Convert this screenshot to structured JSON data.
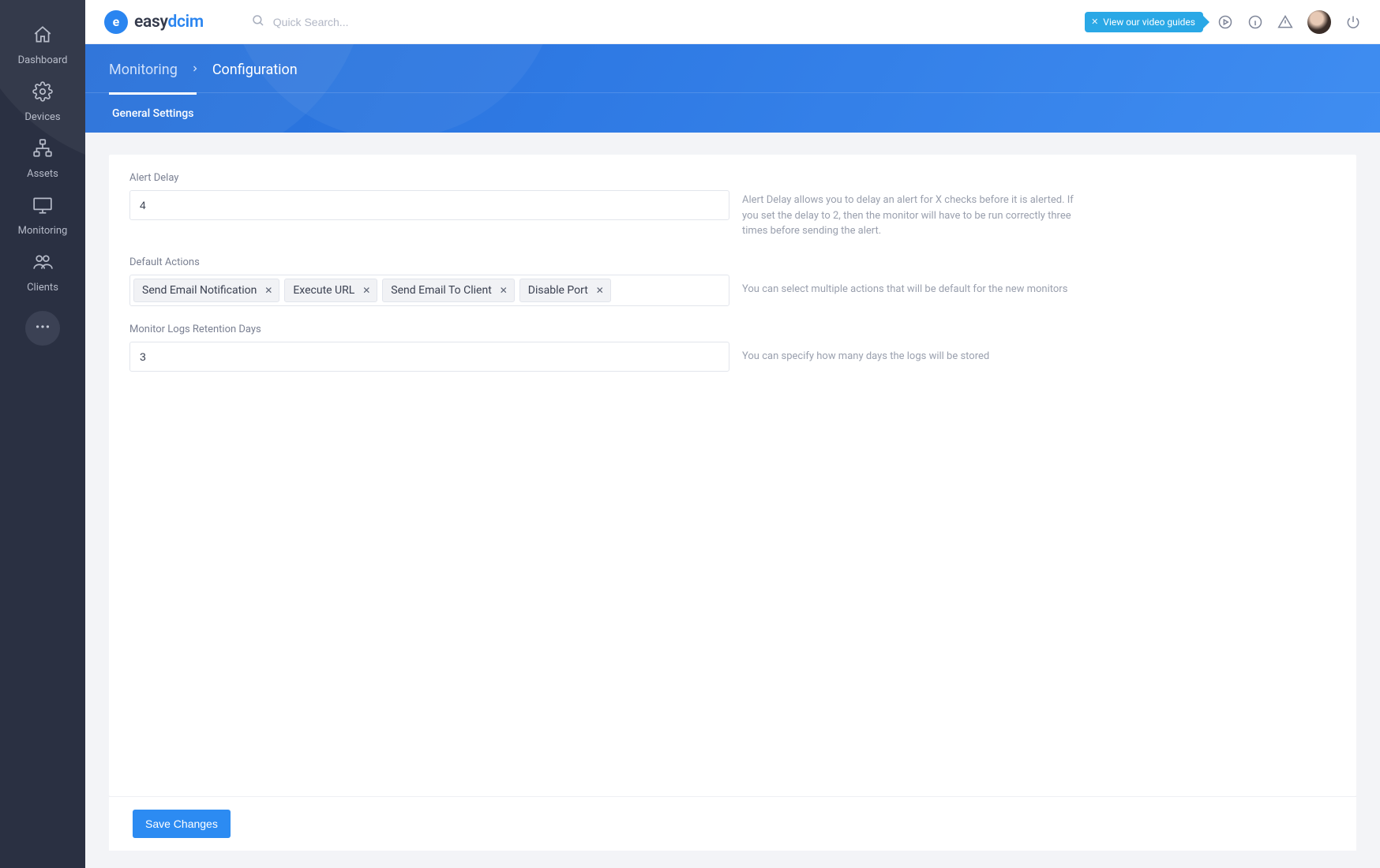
{
  "brand": {
    "part1": "easy",
    "part2": "dcim",
    "mark": "e"
  },
  "search": {
    "placeholder": "Quick Search..."
  },
  "promo": {
    "label": "View our video guides"
  },
  "sidebar": {
    "items": [
      {
        "label": "Dashboard"
      },
      {
        "label": "Devices"
      },
      {
        "label": "Assets"
      },
      {
        "label": "Monitoring"
      },
      {
        "label": "Clients"
      }
    ]
  },
  "breadcrumb": {
    "root": "Monitoring",
    "current": "Configuration"
  },
  "tabs": [
    {
      "label": "General Settings"
    }
  ],
  "form": {
    "alert_delay": {
      "label": "Alert Delay",
      "value": "4",
      "help": "Alert Delay allows you to delay an alert for X checks before it is alerted. If you set the delay to 2, then the monitor will have to be run correctly three times before sending the alert."
    },
    "default_actions": {
      "label": "Default Actions",
      "help": "You can select multiple actions that will be default for the new monitors",
      "chips": [
        "Send Email Notification",
        "Execute URL",
        "Send Email To Client",
        "Disable Port"
      ]
    },
    "retention": {
      "label": "Monitor Logs Retention Days",
      "value": "3",
      "help": "You can specify how many days the logs will be stored"
    }
  },
  "actions": {
    "save": "Save Changes"
  }
}
